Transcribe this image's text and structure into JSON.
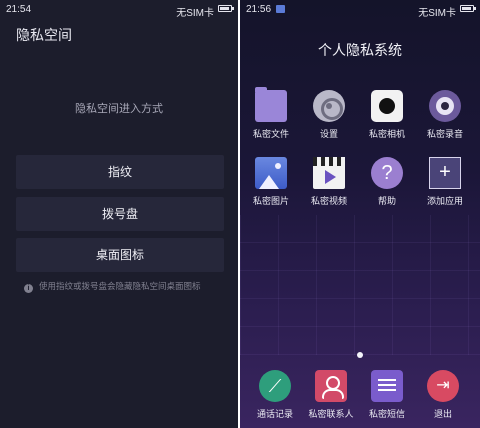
{
  "left": {
    "status": {
      "time": "21:54",
      "sim": "无SIM卡",
      "battery_level": 0.8
    },
    "title": "隐私空间",
    "subtitle": "隐私空间进入方式",
    "options": [
      "指纹",
      "拨号盘",
      "桌面图标"
    ],
    "info": "使用指纹或拨号盘会隐藏隐私空间桌面图标",
    "info_icon_glyph": "i"
  },
  "right": {
    "status": {
      "time": "21:56",
      "sim": "无SIM卡",
      "battery_level": 0.8
    },
    "title": "个人隐私系统",
    "apps": [
      {
        "label": "私密文件",
        "icon": "folder-icon"
      },
      {
        "label": "设置",
        "icon": "gear-icon"
      },
      {
        "label": "私密相机",
        "icon": "camera-icon"
      },
      {
        "label": "私密录音",
        "icon": "recorder-icon"
      },
      {
        "label": "私密图片",
        "icon": "photo-icon"
      },
      {
        "label": "私密视频",
        "icon": "video-icon"
      },
      {
        "label": "帮助",
        "icon": "help-icon",
        "glyph": "?"
      },
      {
        "label": "添加应用",
        "icon": "add-icon",
        "glyph": "+"
      }
    ],
    "dock": [
      {
        "label": "通话记录",
        "icon": "phone-icon",
        "glyph": "⟋"
      },
      {
        "label": "私密联系人",
        "icon": "contacts-icon"
      },
      {
        "label": "私密短信",
        "icon": "sms-icon"
      },
      {
        "label": "退出",
        "icon": "exit-icon",
        "glyph": "⇥"
      }
    ],
    "page_indicator": {
      "current": 1,
      "total": 1
    }
  }
}
